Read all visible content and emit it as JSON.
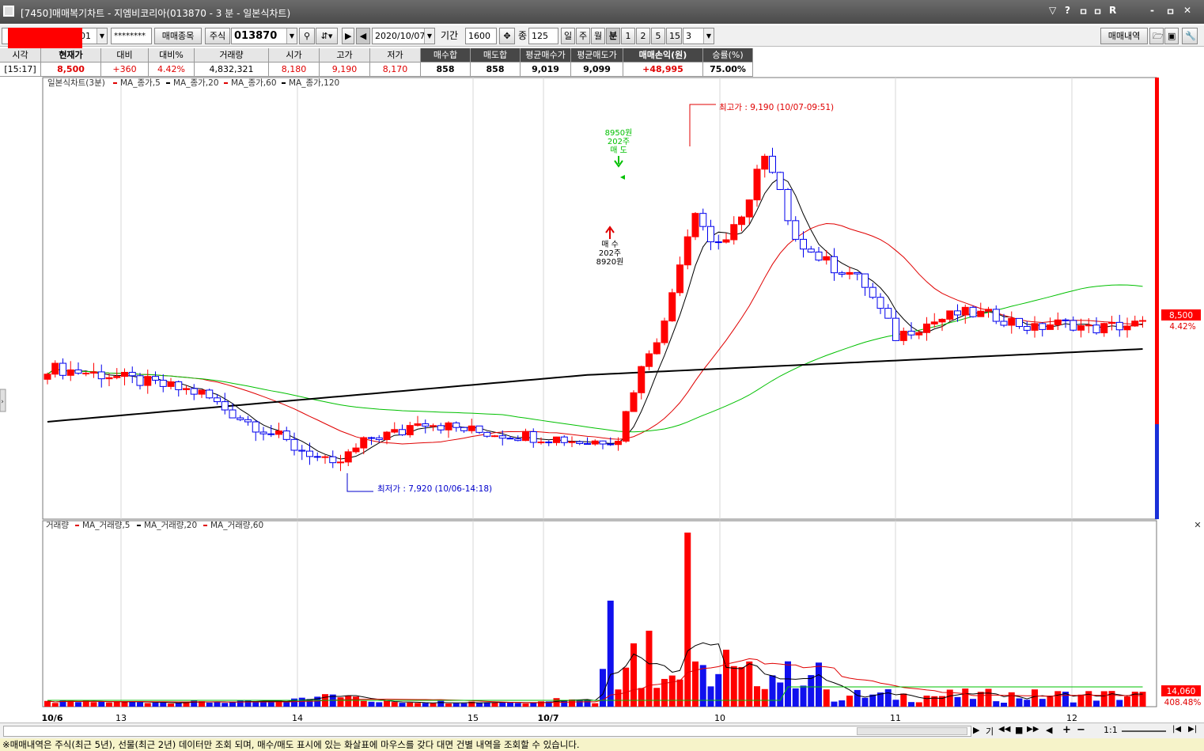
{
  "window": {
    "title": "[7450]매매복기차트 - 지엠비코리아(013870 - 3 분 - 일본식차트)",
    "controls": [
      "▽",
      "?",
      "ㅁ",
      "ㅁ",
      "R",
      "-",
      "ㅁ",
      "✕"
    ]
  },
  "toolbar": {
    "account_tail": "01",
    "password": "********",
    "trade_items_button": "매매종목",
    "market_select": "주식",
    "code_input": "013870",
    "date_input": "2020/10/07",
    "period_label": "기간",
    "period_input": "1600",
    "count_label": "종",
    "count_input": "125",
    "timeframes": [
      "일",
      "주",
      "월",
      "분",
      "1",
      "2",
      "5",
      "15"
    ],
    "active_timeframe": "분",
    "minute_select": "3",
    "trade_history_button": "매매내역"
  },
  "quote": {
    "headers": [
      "시각",
      "현재가",
      "대비",
      "대비%",
      "거래량",
      "시가",
      "고가",
      "저가",
      "매수합",
      "매도합",
      "평균매수가",
      "평균매도가",
      "매매손익(원)",
      "승률(%)"
    ],
    "values": [
      "[15:17]",
      "8,500",
      "+360",
      "4.42%",
      "4,832,321",
      "8,180",
      "9,190",
      "8,170",
      "858",
      "858",
      "9,019",
      "9,099",
      "+48,995",
      "75.00%"
    ]
  },
  "price_legend": {
    "title": "일본식차트(3분)",
    "items": [
      {
        "label": "MA_종가,5",
        "color": "#e00000"
      },
      {
        "label": "MA_종가,20",
        "color": "#000000"
      },
      {
        "label": "MA_종가,60",
        "color": "#e00000"
      },
      {
        "label": "MA_종가,120",
        "color": "#000000"
      }
    ]
  },
  "volume_legend": {
    "title": "거래량",
    "items": [
      {
        "label": "MA_거래량,5",
        "color": "#e00000"
      },
      {
        "label": "MA_거래량,20",
        "color": "#000000"
      },
      {
        "label": "MA_거래량,60",
        "color": "#e00000"
      }
    ]
  },
  "annotations": {
    "high": "최고가 : 9,190 (10/07-09:51)",
    "low": "최저가 : 7,920 (10/06-14:18)",
    "sell": [
      "8950원",
      "202주",
      "매 도"
    ],
    "buy": [
      "매 수",
      "202주",
      "8920원"
    ]
  },
  "price_axis": {
    "value": "8,500",
    "percent": "4.42%"
  },
  "volume_axis": {
    "value": "14,060",
    "percent": "408.48%"
  },
  "colors": {
    "up": "#ff0000",
    "down": "#0000ee",
    "ma60": "#00c000"
  },
  "time_labels": [
    {
      "label": "10/6",
      "bold": true
    },
    {
      "label": "13",
      "bold": false
    },
    {
      "label": "14",
      "bold": false
    },
    {
      "label": "15",
      "bold": false
    },
    {
      "label": "10/7",
      "bold": true
    },
    {
      "label": "10",
      "bold": false
    },
    {
      "label": "11",
      "bold": false
    },
    {
      "label": "12",
      "bold": false
    }
  ],
  "bottom_controls": [
    "기",
    "◀◀",
    "■",
    "▶▶",
    "◀",
    "+",
    "−",
    "1:1",
    "|◀",
    "▶|"
  ],
  "notice": "※매매내역은 주식(최근 5년), 선물(최근 2년) 데이터만 조회 되며, 매수/매도 표시에 있는 화살표에 마우스를 갖다 대면 건별 내역을 조회할 수 있습니다."
}
